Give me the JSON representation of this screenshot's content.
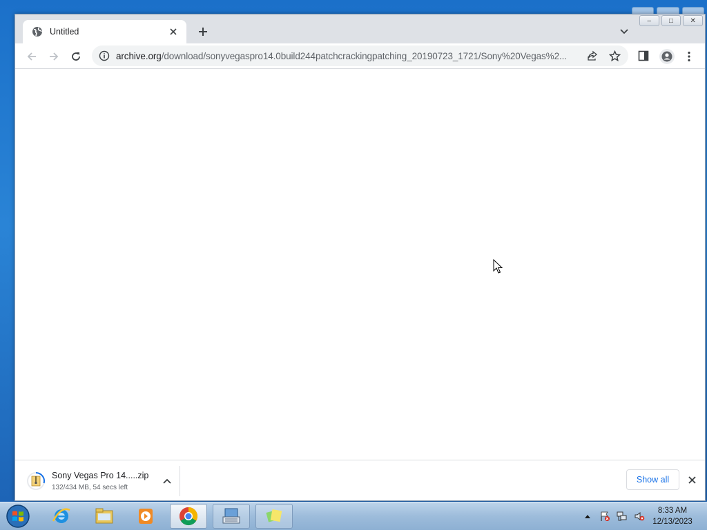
{
  "tab": {
    "title": "Untitled"
  },
  "omnibox": {
    "url_host": "archive.org",
    "url_path": "/download/sonyvegaspro14.0build244patchcrackingpatching_20190723_1721/Sony%20Vegas%2..."
  },
  "window_controls": {
    "minimize": "–",
    "maximize": "□",
    "close": "✕"
  },
  "download": {
    "filename": "Sony Vegas Pro 14.....zip",
    "status": "132/434 MB, 54 secs left",
    "show_all_label": "Show all"
  },
  "taskbar": {
    "apps": [
      "windows-explorer-ie",
      "file-explorer",
      "media-player",
      "chrome",
      "on-screen-keyboard",
      "sticky-notes"
    ],
    "clock_time": "8:33 AM",
    "clock_date": "12/13/2023"
  },
  "colors": {
    "accent": "#1a73e8",
    "tabstrip": "#dee1e6",
    "omnibox": "#f1f3f4",
    "desktop": "#1b70c9"
  }
}
